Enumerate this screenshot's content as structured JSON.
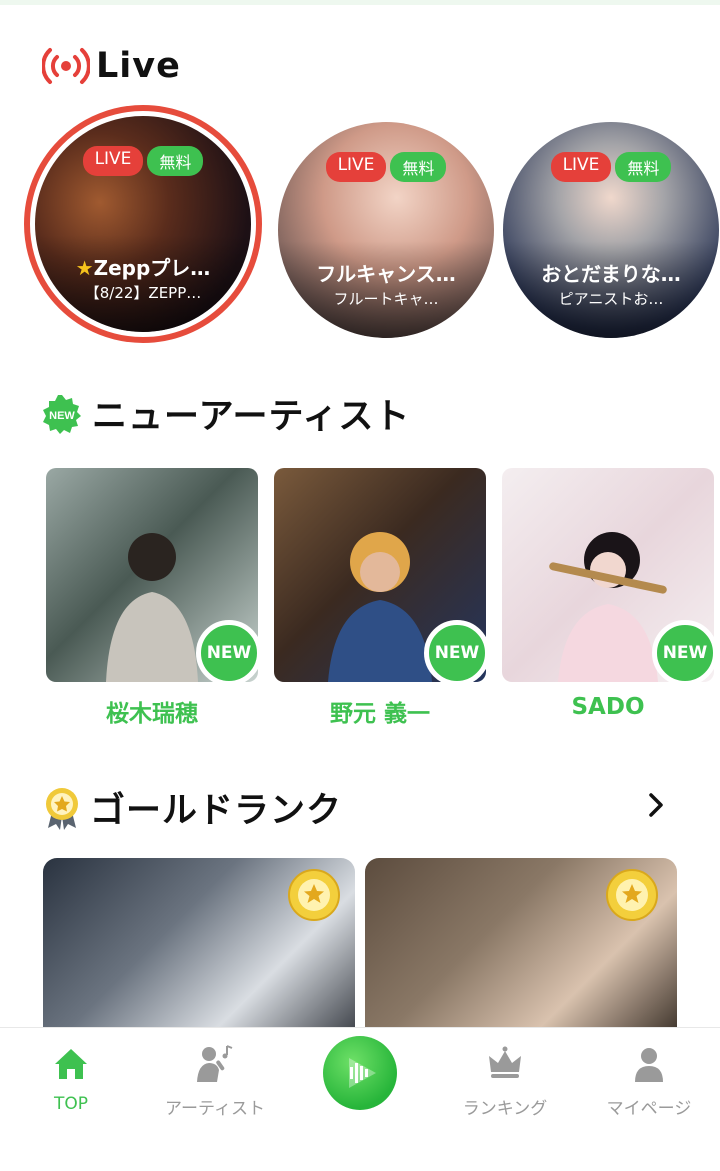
{
  "live": {
    "title": "Live",
    "items": [
      {
        "live_badge": "LIVE",
        "free_badge": "無料",
        "title": "Zeppプレ…",
        "subtitle": "【8/22】ZEPP…"
      },
      {
        "live_badge": "LIVE",
        "free_badge": "無料",
        "title": "フルキャンス…",
        "subtitle": "フルートキャ…"
      },
      {
        "live_badge": "LIVE",
        "free_badge": "無料",
        "title": "おとだまりな…",
        "subtitle": "ピアニストお…"
      }
    ]
  },
  "new_artists": {
    "title": "ニューアーティスト",
    "badge_icon_text": "NEW",
    "items": [
      {
        "name": "桜木瑞穂",
        "badge": "NEW"
      },
      {
        "name": "野元 義一",
        "badge": "NEW"
      },
      {
        "name": "SADO",
        "badge": "NEW"
      }
    ]
  },
  "gold_rank": {
    "title": "ゴールドランク"
  },
  "nav": {
    "items": [
      {
        "label": "TOP",
        "active": true
      },
      {
        "label": "アーティスト",
        "active": false
      },
      {
        "label": "ランキング",
        "active": false
      },
      {
        "label": "マイページ",
        "active": false
      }
    ]
  },
  "colors": {
    "accent_green": "#3ec150",
    "live_red": "#e5403a",
    "ring_red": "#e64c3c"
  }
}
